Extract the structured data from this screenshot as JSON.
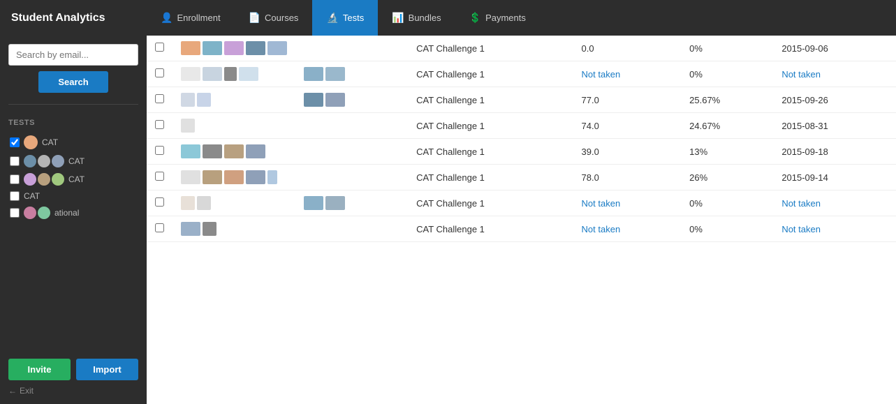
{
  "app": {
    "title": "Student Analytics"
  },
  "nav": {
    "tabs": [
      {
        "id": "enrollment",
        "label": "Enrollment",
        "icon": "👤",
        "active": false
      },
      {
        "id": "courses",
        "label": "Courses",
        "icon": "📄",
        "active": false
      },
      {
        "id": "tests",
        "label": "Tests",
        "icon": "🔬",
        "active": true
      },
      {
        "id": "bundles",
        "label": "Bundles",
        "icon": "📊",
        "active": false
      },
      {
        "id": "payments",
        "label": "Payments",
        "icon": "💲",
        "active": false
      }
    ]
  },
  "sidebar": {
    "search_placeholder": "Search by email...",
    "search_button": "Search",
    "section_label": "TESTS",
    "tests": [
      {
        "id": 1,
        "checked": true,
        "label": "CAT"
      },
      {
        "id": 2,
        "checked": false,
        "label": "CAT"
      },
      {
        "id": 3,
        "checked": false,
        "label": "CAT"
      },
      {
        "id": 4,
        "checked": false,
        "label": "CAT"
      },
      {
        "id": 5,
        "checked": false,
        "label": "ational"
      }
    ],
    "invite_button": "Invite",
    "import_button": "Import",
    "exit_label": "Exit"
  },
  "table": {
    "rows": [
      {
        "id": 1,
        "test_name": "CAT Challenge 1",
        "score": "0.0",
        "percent": "0%",
        "date": "2015-09-06",
        "not_taken": false
      },
      {
        "id": 2,
        "test_name": "CAT Challenge 1",
        "score": "Not taken",
        "percent": "0%",
        "date": "Not taken",
        "not_taken": true
      },
      {
        "id": 3,
        "test_name": "CAT Challenge 1",
        "score": "77.0",
        "percent": "25.67%",
        "date": "2015-09-26",
        "not_taken": false
      },
      {
        "id": 4,
        "test_name": "CAT Challenge 1",
        "score": "74.0",
        "percent": "24.67%",
        "date": "2015-08-31",
        "not_taken": false
      },
      {
        "id": 5,
        "test_name": "CAT Challenge 1",
        "score": "39.0",
        "percent": "13%",
        "date": "2015-09-18",
        "not_taken": false
      },
      {
        "id": 6,
        "test_name": "CAT Challenge 1",
        "score": "78.0",
        "percent": "26%",
        "date": "2015-09-14",
        "not_taken": false
      },
      {
        "id": 7,
        "test_name": "CAT Challenge 1",
        "score": "Not taken",
        "percent": "0%",
        "date": "Not taken",
        "not_taken": true
      },
      {
        "id": 8,
        "test_name": "CAT Challenge 1",
        "score": "Not taken",
        "percent": "0%",
        "date": "Not taken",
        "not_taken": true
      }
    ]
  }
}
